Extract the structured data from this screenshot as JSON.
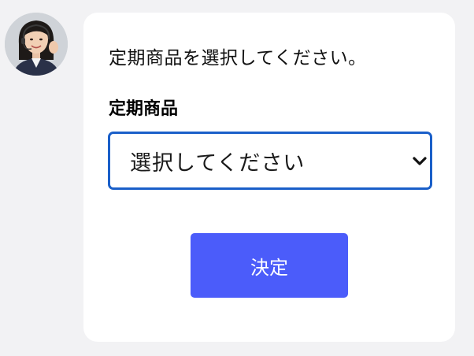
{
  "chat": {
    "avatar_icon": "operator-avatar",
    "prompt_text": "定期商品を選択してください。"
  },
  "form": {
    "field_label": "定期商品",
    "select": {
      "selected_value": "選択してください",
      "border_color": "#1a5fc9"
    },
    "submit_label": "決定",
    "submit_color": "#4b5cfa"
  }
}
